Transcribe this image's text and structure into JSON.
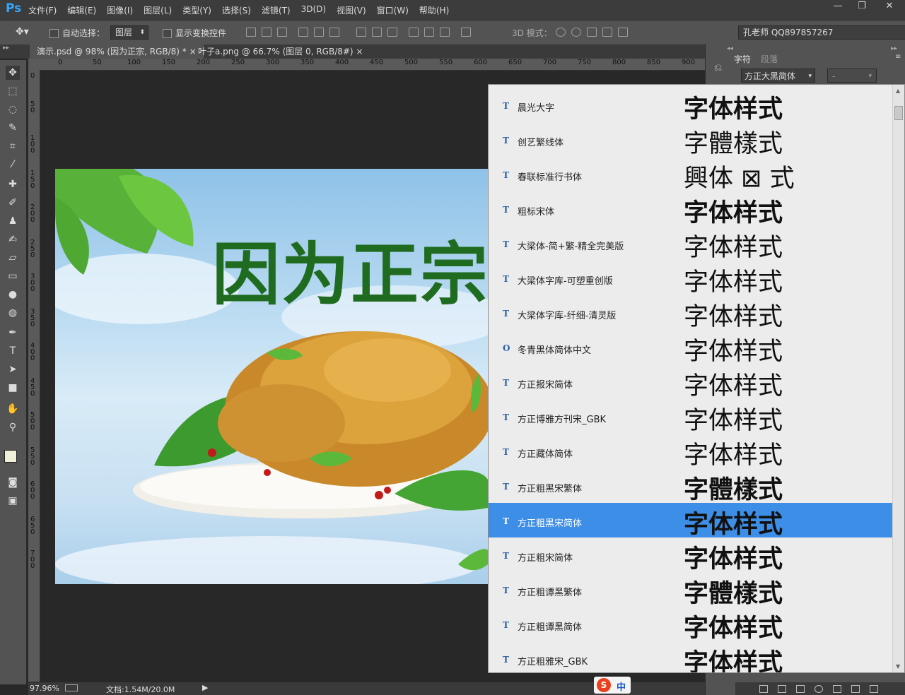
{
  "app": {
    "logo": "Ps"
  },
  "menu": [
    "文件(F)",
    "编辑(E)",
    "图像(I)",
    "图层(L)",
    "类型(Y)",
    "选择(S)",
    "滤镜(T)",
    "3D(D)",
    "视图(V)",
    "窗口(W)",
    "帮助(H)"
  ],
  "window_buttons": {
    "minimize": "—",
    "restore": "❐",
    "close": "✕"
  },
  "options": {
    "auto_select_label": "自动选择：",
    "auto_select_value": "图层",
    "show_transform_label": "显示变换控件",
    "mode_3d_label": "3D 模式：",
    "workspace": "孔老师 QQ897857267"
  },
  "tabs": [
    {
      "label": "演示.psd @ 98% (因为正宗, RGB/8) *",
      "close": "×"
    },
    {
      "label": "叶子a.png @ 66.7% (图层 0, RGB/8#)",
      "close": "×"
    }
  ],
  "ruler_h": [
    "0",
    "50",
    "100",
    "150",
    "200",
    "250",
    "300",
    "350",
    "400",
    "450",
    "500",
    "550",
    "600",
    "650",
    "700",
    "750",
    "800",
    "850",
    "900"
  ],
  "ruler_v": [
    "0",
    "50",
    "100",
    "150",
    "200",
    "250",
    "300",
    "350",
    "400",
    "450",
    "500",
    "550",
    "600",
    "650",
    "700"
  ],
  "canvas": {
    "headline": "因为正宗"
  },
  "status": {
    "zoom": "97.96%",
    "doc": "文档:1.54M/20.0M"
  },
  "panel": {
    "tab_char": "字符",
    "tab_para": "段落",
    "font_family": "方正大黑简体",
    "font_style": "-"
  },
  "font_list": {
    "sample_text": "字体样式",
    "items": [
      {
        "icon": "T",
        "name": "晨光大字",
        "sample": "字体样式"
      },
      {
        "icon": "T",
        "name": "创艺繁线体",
        "sample": "字體樣式"
      },
      {
        "icon": "T",
        "name": "春联标准行书体",
        "sample": "興体 ⊠ 式"
      },
      {
        "icon": "T",
        "name": "粗标宋体",
        "sample": "字体样式"
      },
      {
        "icon": "T",
        "name": "大梁体-简+繁-精全完美版",
        "sample": "字体样式"
      },
      {
        "icon": "T",
        "name": "大梁体字库-可塑重创版",
        "sample": "字体样式"
      },
      {
        "icon": "T",
        "name": "大梁体字库-纤细-清灵版",
        "sample": "字体样式"
      },
      {
        "icon": "O",
        "name": "冬青黑体简体中文",
        "sample": "字体样式"
      },
      {
        "icon": "T",
        "name": "方正报宋简体",
        "sample": "字体样式"
      },
      {
        "icon": "T",
        "name": "方正博雅方刊宋_GBK",
        "sample": "字体样式"
      },
      {
        "icon": "T",
        "name": "方正藏体简体",
        "sample": "字体样式"
      },
      {
        "icon": "T",
        "name": "方正粗黑宋繁体",
        "sample": "字體樣式"
      },
      {
        "icon": "T",
        "name": "方正粗黑宋简体",
        "sample": "字体样式"
      },
      {
        "icon": "T",
        "name": "方正粗宋简体",
        "sample": "字体样式"
      },
      {
        "icon": "T",
        "name": "方正粗谭黑繁体",
        "sample": "字體樣式"
      },
      {
        "icon": "T",
        "name": "方正粗谭黑简体",
        "sample": "字体样式"
      },
      {
        "icon": "T",
        "name": "方正粗雅宋_GBK",
        "sample": "字体样式"
      }
    ],
    "selected_index": 12
  },
  "ime": {
    "logo": "S",
    "mode": "中"
  },
  "colors": {
    "accent": "#3d8ee6",
    "headline": "#1f6b1f",
    "ps_blue": "#31a8ff"
  }
}
